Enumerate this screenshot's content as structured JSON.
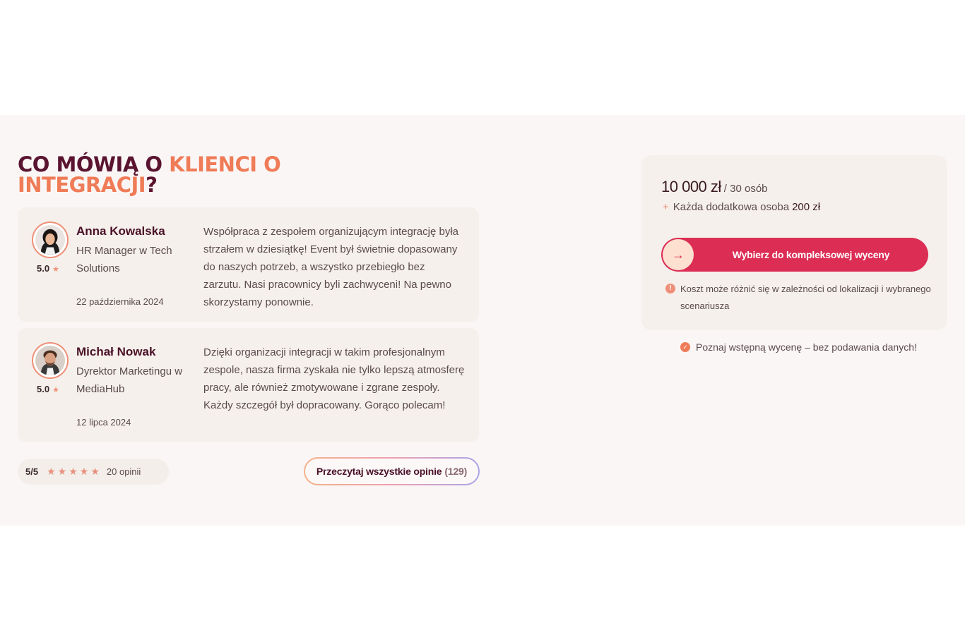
{
  "colors": {
    "brand_dark": "#5a1430",
    "accent": "#ef7b57",
    "cta": "#dc2d55",
    "card_bg": "#f5f0eb",
    "section_bg": "#faf6f5"
  },
  "heading": {
    "part1": "CO MÓWIĄ O ",
    "part2": "KLIENCI O INTEGRACJI",
    "part3": "?"
  },
  "reviews": [
    {
      "name": "Anna Kowalska",
      "role": "HR Manager w Tech Solutions",
      "rating": "5.0",
      "date": "22 października 2024",
      "quote": "Współpraca z zespołem organizującym integrację była strzałem w dziesiątkę! Event był świetnie dopasowany do naszych potrzeb, a wszystko przebiegło bez zarzutu. Nasi pracownicy byli zachwyceni! Na pewno skorzystamy ponownie.",
      "avatar_icon": "woman-portrait-icon"
    },
    {
      "name": "Michał Nowak",
      "role": "Dyrektor Marketingu w MediaHub",
      "rating": "5.0",
      "date": "12 lipca 2024",
      "quote": "Dzięki organizacji integracji w takim profesjonalnym zespole, nasza firma zyskała nie tylko lepszą atmosferę pracy, ale również zmotywowane i zgrane zespoły. Każdy szczegół był dopracowany. Gorąco polecam!",
      "avatar_icon": "man-portrait-icon"
    }
  ],
  "summary": {
    "score": "5/5",
    "stars_count": 5,
    "count_label": "20 opinii"
  },
  "all_reviews_button": {
    "label": "Przeczytaj wszystkie opinie",
    "count": "(129)"
  },
  "pricing": {
    "price": "10 000 zł",
    "per": "/ 30 osób",
    "extra_label": "Każda dodatkowa osoba",
    "extra_amount": "200 zł",
    "cta_label": "Wybierz do kompleksowej wyceny",
    "note": "Koszt może różnić się w zależności od lokalizacji i wybranego scenariusza",
    "free_note": "Poznaj wstępną wycenę – bez podawania danych!"
  }
}
